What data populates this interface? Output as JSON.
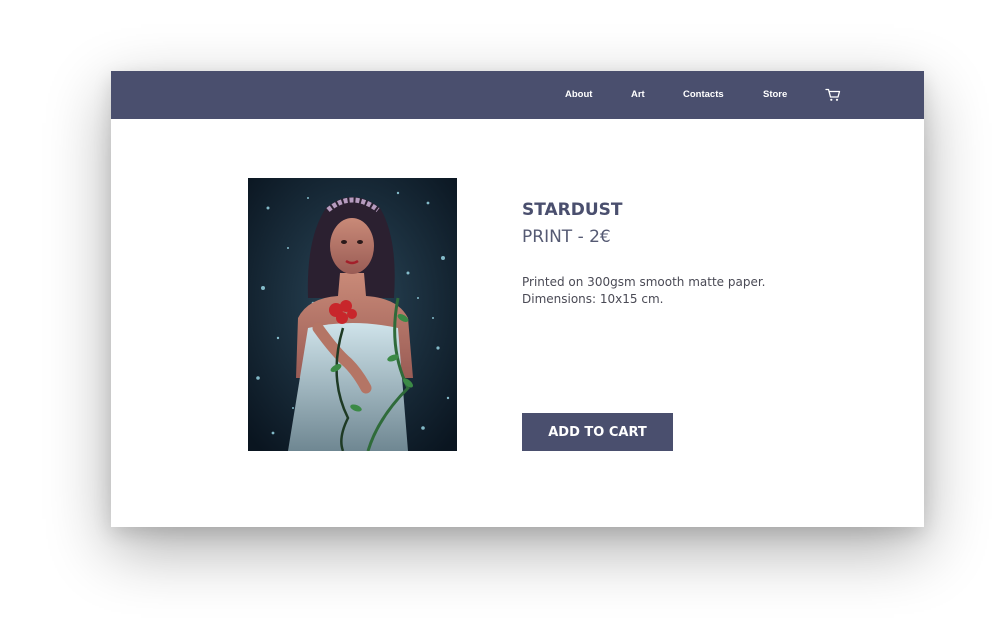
{
  "nav": {
    "about": "About",
    "art": "Art",
    "contacts": "Contacts",
    "store": "Store",
    "cart_icon": "shopping-cart-icon"
  },
  "product": {
    "title": "STARDUST",
    "price_line": "PRINT - 2€",
    "description_line1": "Printed on 300gsm smooth matte paper.",
    "description_line2": "Dimensions: 10x15 cm.",
    "button_label": "ADD TO CART"
  },
  "colors": {
    "brand": "#4a4f6e",
    "artwork_background": "#0f1c2a",
    "rose": "#c8262b",
    "leaves": "#2f6b3a"
  }
}
